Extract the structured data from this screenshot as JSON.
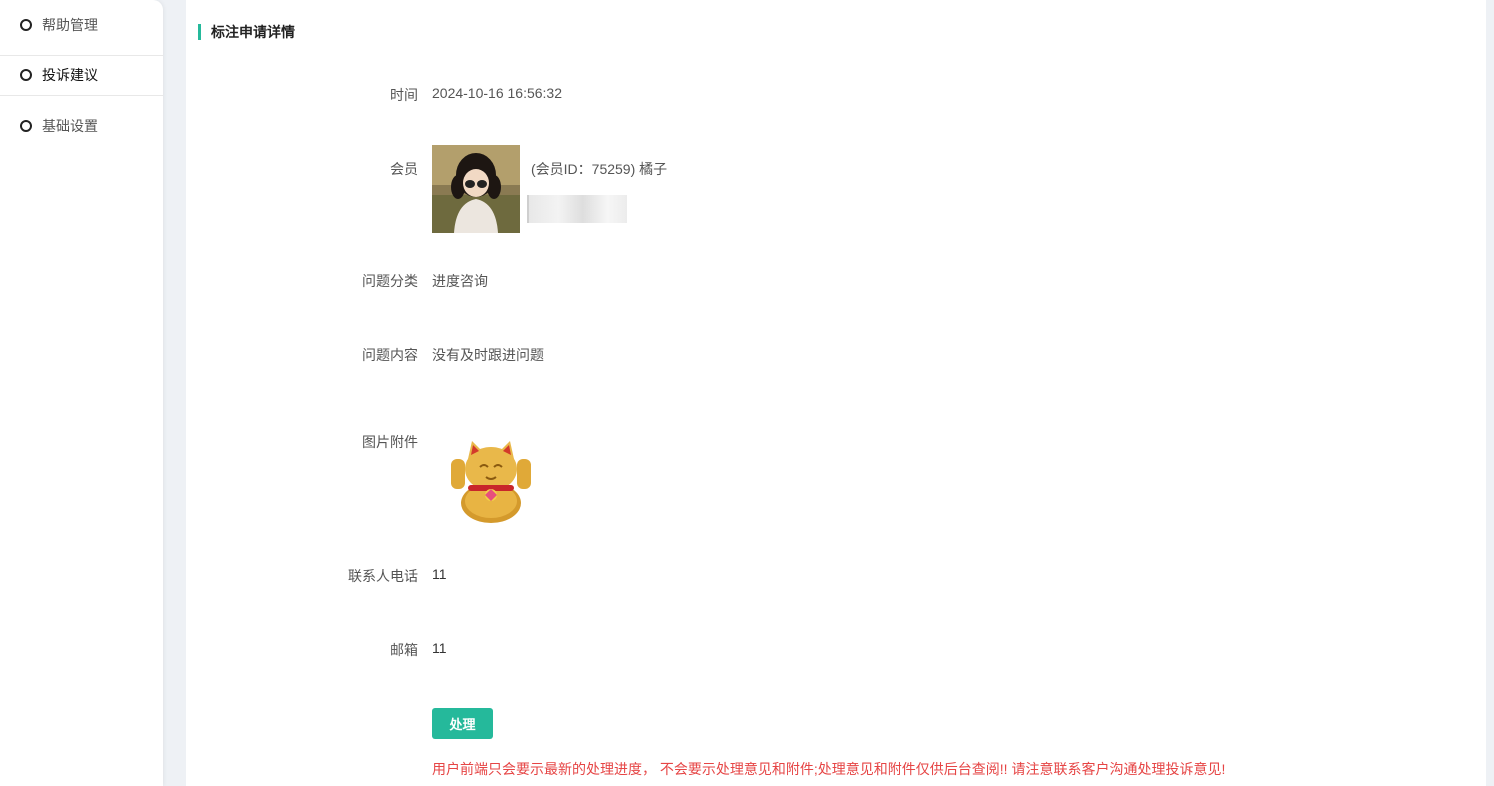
{
  "sidebar": {
    "items": [
      {
        "label": "帮助管理",
        "active": false
      },
      {
        "label": "投诉建议",
        "active": true
      },
      {
        "label": "基础设置",
        "active": false
      }
    ]
  },
  "panel": {
    "title": "标注申请详情"
  },
  "details": {
    "time_label": "时间",
    "time_value": "2024-10-16 16:56:32",
    "member_label": "会员",
    "member_value": "(会员ID：75259) 橘子",
    "category_label": "问题分类",
    "category_value": "进度咨询",
    "content_label": "问题内容",
    "content_value": "没有及时跟进问题",
    "attachment_label": "图片附件",
    "phone_label": "联系人电话",
    "phone_value": "11",
    "email_label": "邮箱",
    "email_value": "11"
  },
  "actions": {
    "process_label": "处理"
  },
  "notice": "用户前端只会要示最新的处理进度， 不会要示处理意见和附件;处理意见和附件仅供后台查阅!! 请注意联系客户沟通处理投诉意见!",
  "colors": {
    "accent": "#25b99b",
    "notice": "#e64545"
  }
}
